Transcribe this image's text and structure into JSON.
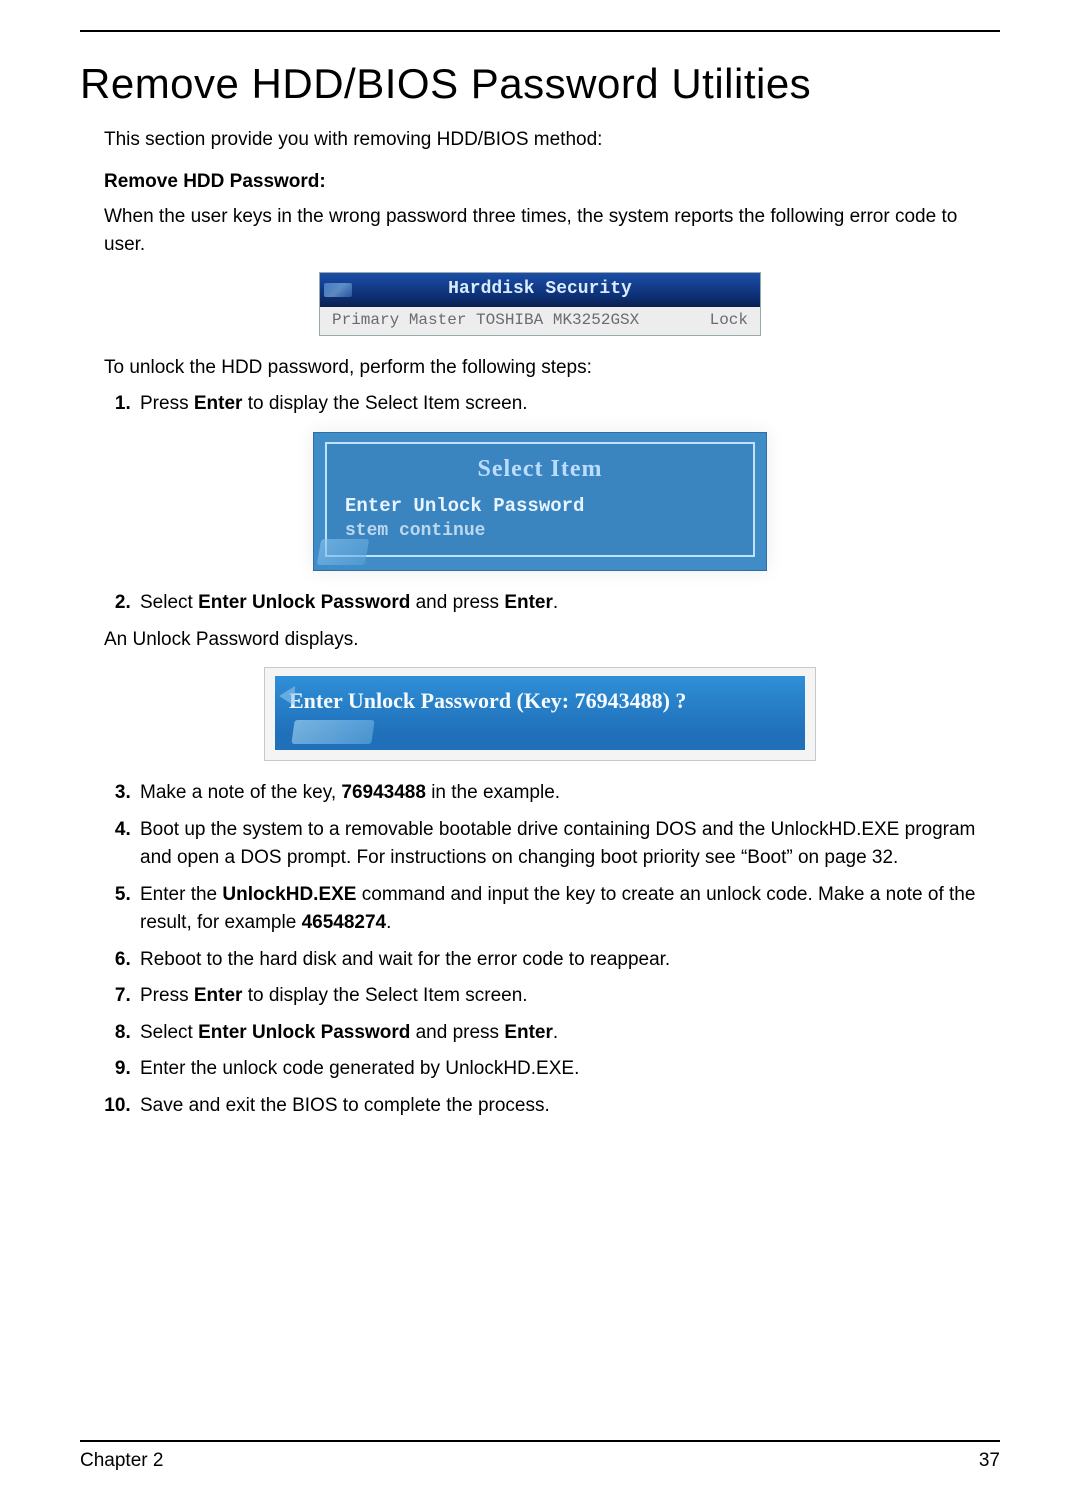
{
  "title": "Remove HDD/BIOS Password Utilities",
  "intro": "This section provide you with removing HDD/BIOS method:",
  "sub_heading": "Remove HDD Password:",
  "wrong_pw_text": "When the user keys in the wrong password three times, the system reports the following error code to user.",
  "fig1": {
    "header": "Harddisk  Security",
    "left": "Primary  Master  TOSHIBA MK3252GSX",
    "right": "Lock"
  },
  "unlock_steps_intro": "To unlock the HDD password, perform the following steps:",
  "step1_pre": "Press ",
  "step1_bold": "Enter",
  "step1_post": " to display the Select Item screen.",
  "fig2": {
    "title": "Select  Item",
    "opt1": "Enter Unlock Password",
    "opt2": "stem continue"
  },
  "step2_pre": "Select ",
  "step2_bold1": "Enter Unlock Password",
  "step2_mid": " and press ",
  "step2_bold2": "Enter",
  "step2_post": ".",
  "unlock_displays": "An Unlock Password displays.",
  "fig3": {
    "line": "Enter  Unlock  Password (Key: 76943488) ?"
  },
  "step3_pre": "Make a note of the key, ",
  "step3_bold": "76943488",
  "step3_post": " in the example.",
  "step4": "Boot up the system to a removable bootable drive containing DOS and the UnlockHD.EXE program and open a DOS prompt. For instructions on changing boot priority see “Boot” on page 32.",
  "step5_pre": "Enter the ",
  "step5_bold1": "UnlockHD.EXE",
  "step5_mid": " command and input the key to create an unlock code. Make a note of the result, for example ",
  "step5_bold2": "46548274",
  "step5_post": ".",
  "step6": "Reboot to the hard disk and wait for the error code to reappear.",
  "step7_pre": "Press ",
  "step7_bold": "Enter",
  "step7_post": " to display the Select Item screen.",
  "step8_pre": "Select ",
  "step8_bold1": "Enter Unlock Password",
  "step8_mid": " and press ",
  "step8_bold2": "Enter",
  "step8_post": ".",
  "step9": "Enter the unlock code generated by UnlockHD.EXE.",
  "step10": "Save and exit the BIOS to complete the process.",
  "footer_left": "Chapter 2",
  "footer_right": "37"
}
